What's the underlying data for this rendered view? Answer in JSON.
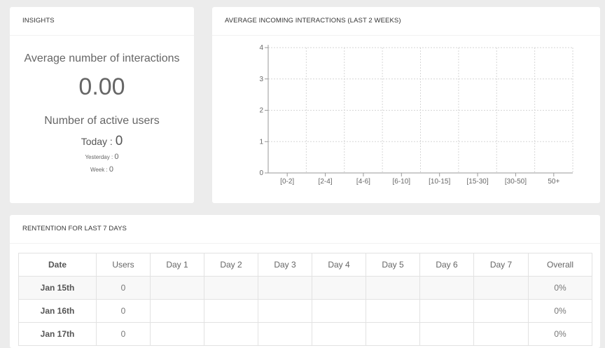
{
  "insights": {
    "title": "INSIGHTS",
    "avg_label": "Average number of interactions",
    "avg_value": "0.00",
    "users_label": "Number of active users",
    "today_label": "Today : ",
    "today_value": "0",
    "yesterday_label": "Yesterday : ",
    "yesterday_value": "0",
    "week_label": "Week : ",
    "week_value": "0"
  },
  "chart": {
    "title": "AVERAGE INCOMING INTERACTIONS (LAST 2 WEEKS)"
  },
  "chart_data": {
    "type": "bar",
    "categories": [
      "[0-2]",
      "[2-4]",
      "[4-6]",
      "[6-10]",
      "[10-15]",
      "[15-30]",
      "[30-50]",
      "50+"
    ],
    "values": [
      0,
      0,
      0,
      0,
      0,
      0,
      0,
      0
    ],
    "yticks": [
      0,
      1,
      2,
      3,
      4
    ],
    "ylim": [
      0,
      4
    ],
    "grid": true,
    "xlabel": "",
    "ylabel": ""
  },
  "retention": {
    "title": "RENTENTION FOR LAST 7 DAYS",
    "headers": [
      "Date",
      "Users",
      "Day 1",
      "Day 2",
      "Day 3",
      "Day 4",
      "Day 5",
      "Day 6",
      "Day 7",
      "Overall"
    ],
    "rows": [
      {
        "date": "Jan 15th",
        "users": "0",
        "day1": "",
        "day2": "",
        "day3": "",
        "day4": "",
        "day5": "",
        "day6": "",
        "day7": "",
        "overall": "0%"
      },
      {
        "date": "Jan 16th",
        "users": "0",
        "day1": "",
        "day2": "",
        "day3": "",
        "day4": "",
        "day5": "",
        "day6": "",
        "day7": "",
        "overall": "0%"
      },
      {
        "date": "Jan 17th",
        "users": "0",
        "day1": "",
        "day2": "",
        "day3": "",
        "day4": "",
        "day5": "",
        "day6": "",
        "day7": "",
        "overall": "0%"
      }
    ]
  }
}
